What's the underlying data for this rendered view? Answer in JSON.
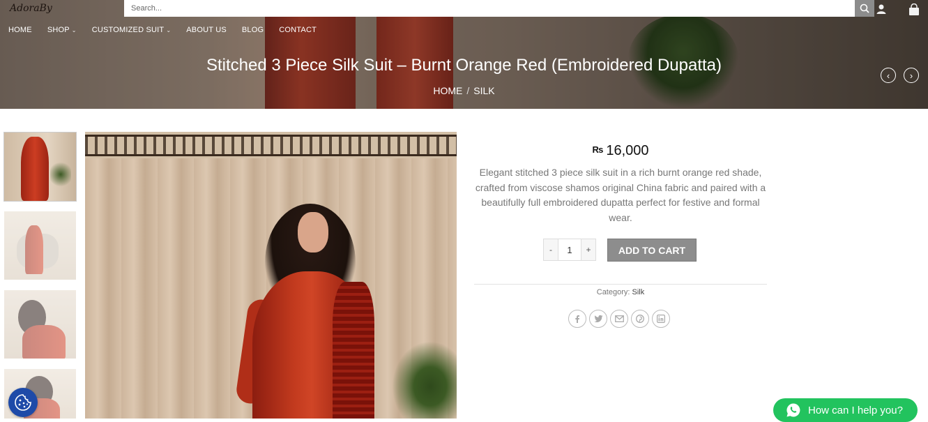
{
  "header": {
    "logo_text": "AdoraBy",
    "search": {
      "placeholder": "Search..."
    },
    "nav": [
      {
        "label": "HOME",
        "has_dropdown": false
      },
      {
        "label": "SHOP",
        "has_dropdown": true
      },
      {
        "label": "CUSTOMIZED SUIT",
        "has_dropdown": true
      },
      {
        "label": "ABOUT US",
        "has_dropdown": false
      },
      {
        "label": "BLOG",
        "has_dropdown": false
      },
      {
        "label": "CONTACT",
        "has_dropdown": false
      }
    ],
    "icons": {
      "search": "search-icon",
      "account": "user-icon",
      "cart": "shopping-bag-icon"
    }
  },
  "hero": {
    "title": "Stitched 3 Piece Silk Suit – Burnt Orange Red (Embroidered Dupatta)",
    "breadcrumb": [
      "HOME",
      "SILK"
    ],
    "breadcrumb_separator": "/"
  },
  "product": {
    "currency_symbol": "₨",
    "price": "16,000",
    "description": "Elegant stitched 3 piece silk suit in a rich burnt orange red shade, crafted from viscose shamos original China fabric and paired with a beautifully full embroidered dupatta perfect for festive and formal wear.",
    "quantity": {
      "minus": "-",
      "value": "1",
      "plus": "+"
    },
    "add_to_cart": "ADD TO CART",
    "category_label": "Category:",
    "category_value": "Silk",
    "share_icons": [
      "facebook-icon",
      "twitter-icon",
      "email-icon",
      "pinterest-icon",
      "linkedin-icon"
    ]
  },
  "floating": {
    "cookie_icon": "cookie-icon",
    "whatsapp_label": "How can I help you?"
  },
  "colors": {
    "accent_button": "#8d8d8d",
    "whatsapp": "#22c35e",
    "cookie": "#1e4aa8"
  }
}
